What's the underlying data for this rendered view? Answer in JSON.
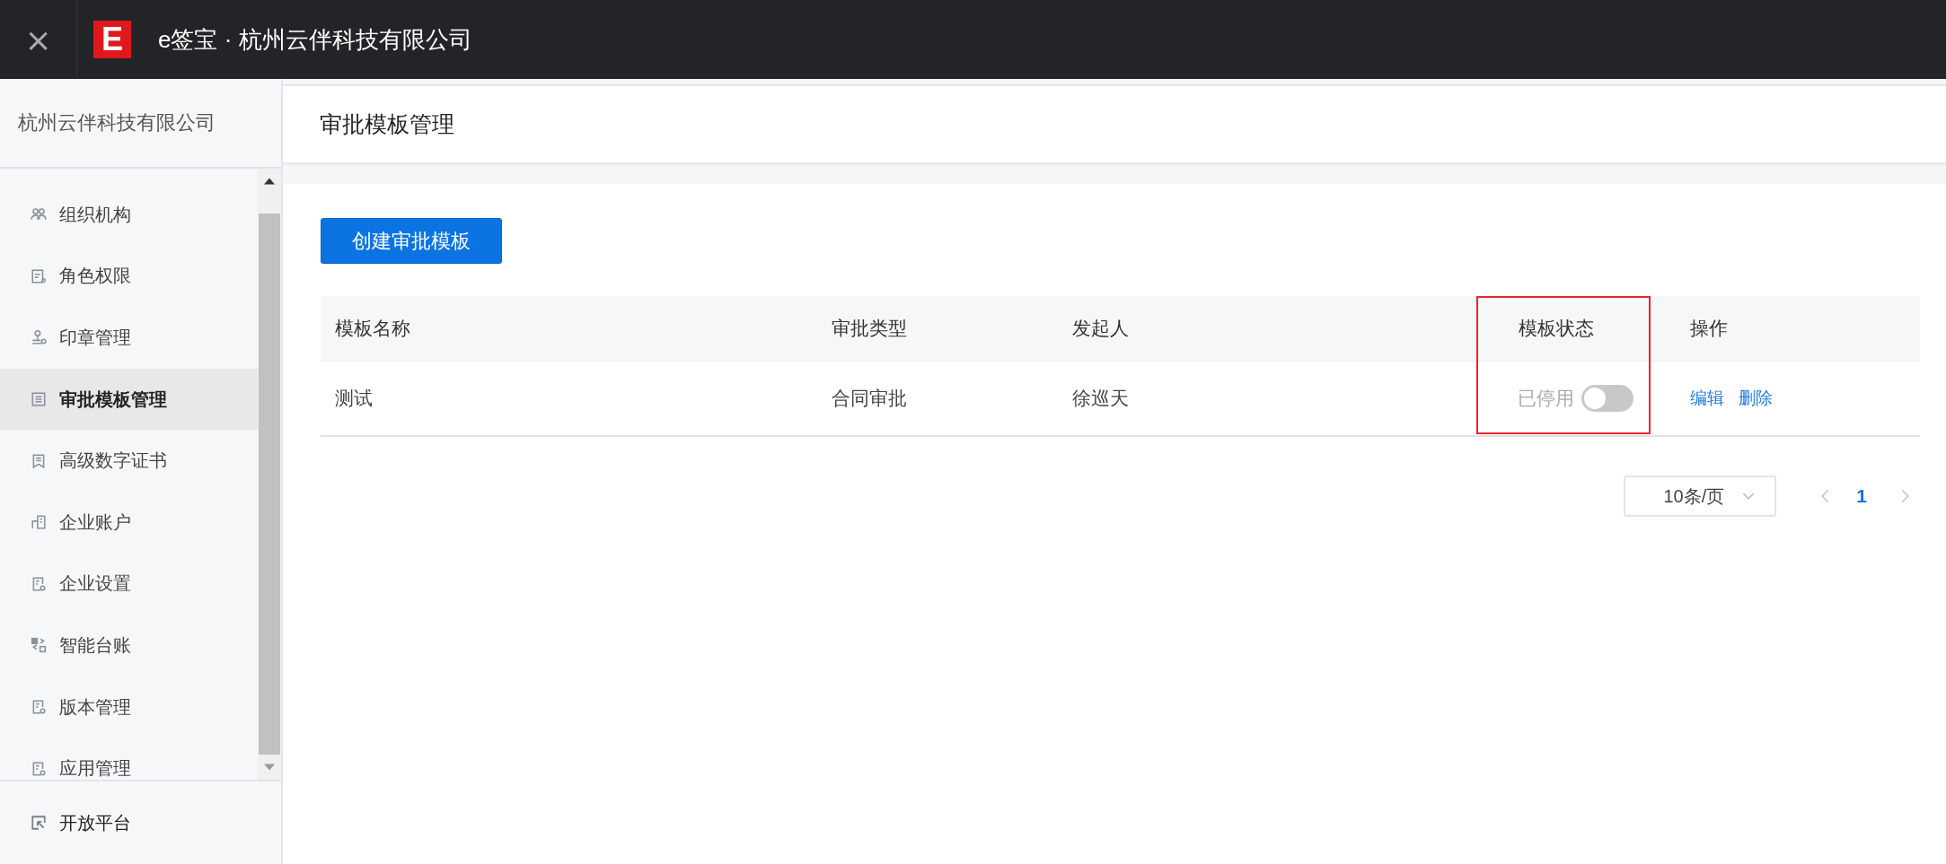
{
  "topbar": {
    "close": "×",
    "logo": "E",
    "title": "e签宝 · 杭州云伴科技有限公司"
  },
  "sidebar": {
    "company": "杭州云伴科技有限公司",
    "items": [
      {
        "label": "组织机构",
        "selected": false
      },
      {
        "label": "角色权限",
        "selected": false
      },
      {
        "label": "印章管理",
        "selected": false
      },
      {
        "label": "审批模板管理",
        "selected": true
      },
      {
        "label": "高级数字证书",
        "selected": false
      },
      {
        "label": "企业账户",
        "selected": false
      },
      {
        "label": "企业设置",
        "selected": false
      },
      {
        "label": "智能台账",
        "selected": false
      },
      {
        "label": "版本管理",
        "selected": false
      },
      {
        "label": "应用管理",
        "selected": false
      }
    ],
    "footer_item": "开放平台"
  },
  "page_title": "审批模板管理",
  "create_button": "创建审批模板",
  "table": {
    "columns": [
      "模板名称",
      "审批类型",
      "发起人",
      "模板状态",
      "操作"
    ],
    "rows": [
      {
        "name": "测试",
        "type": "合同审批",
        "initiator": "徐巡天",
        "status": {
          "label": "已停用",
          "on": false
        },
        "actions": [
          "编辑",
          "删除"
        ]
      }
    ]
  },
  "pagination": {
    "page_size": "10条/页",
    "pages": [
      {
        "label": "1",
        "selected": true
      }
    ]
  }
}
